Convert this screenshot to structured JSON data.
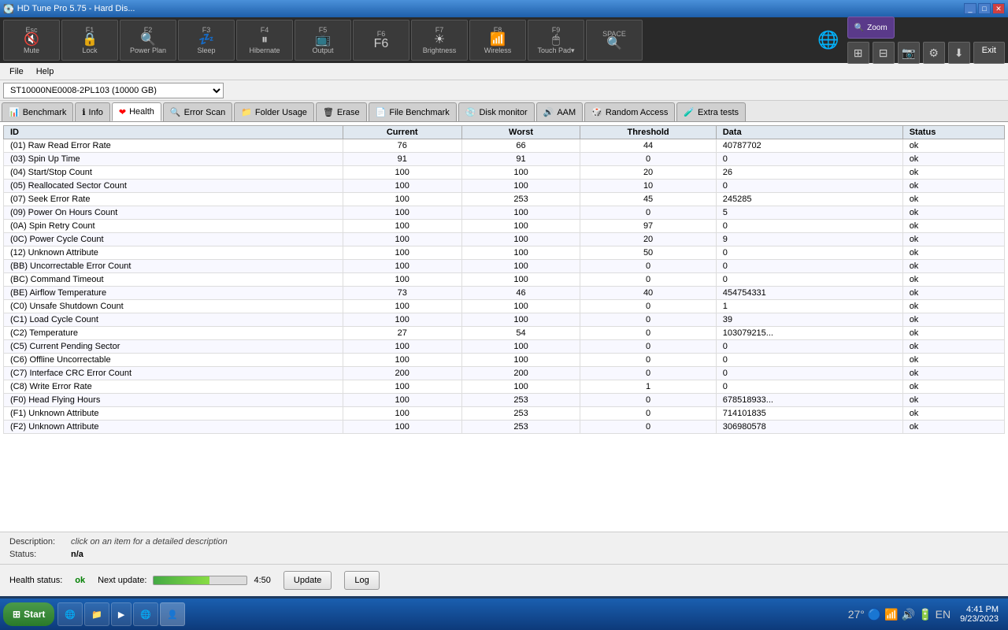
{
  "window": {
    "title": "HD Tune Pro 5.75 - Hard Dis...",
    "icon": "💽"
  },
  "fkeys": [
    {
      "key": "Esc",
      "icon": "🔇",
      "label": "Mute"
    },
    {
      "key": "F1",
      "icon": "🔒",
      "label": "Lock"
    },
    {
      "key": "F2",
      "icon": "🔍",
      "label": "Power Plan"
    },
    {
      "key": "F3",
      "icon": "💤",
      "label": "Sleep"
    },
    {
      "key": "F4",
      "icon": "⏸",
      "label": "Hibernate"
    },
    {
      "key": "F5",
      "icon": "📺",
      "label": "Output"
    },
    {
      "key": "F6",
      "icon": "F6",
      "label": ""
    },
    {
      "key": "F7",
      "icon": "☀",
      "label": "Brightness"
    },
    {
      "key": "F8",
      "icon": "📶",
      "label": "Wireless"
    },
    {
      "key": "F9",
      "icon": "🖱",
      "label": "Touch Pad"
    },
    {
      "key": "SPACE",
      "icon": "🔍",
      "label": "Zoom"
    }
  ],
  "menu": {
    "items": [
      "File",
      "Help"
    ]
  },
  "drive": {
    "label": "ST10000NE0008-2PL103 (10000 GB)"
  },
  "tabs": [
    {
      "label": "Benchmark",
      "icon": "📊"
    },
    {
      "label": "Info",
      "icon": "ℹ"
    },
    {
      "label": "Health",
      "icon": "❤",
      "active": true
    },
    {
      "label": "Error Scan",
      "icon": "🔍"
    },
    {
      "label": "Folder Usage",
      "icon": "📁"
    },
    {
      "label": "Erase",
      "icon": "🗑"
    },
    {
      "label": "File Benchmark",
      "icon": "📄"
    },
    {
      "label": "Disk monitor",
      "icon": "💿"
    },
    {
      "label": "AAM",
      "icon": "🔊"
    },
    {
      "label": "Random Access",
      "icon": "🎲"
    },
    {
      "label": "Extra tests",
      "icon": "🧪"
    }
  ],
  "table": {
    "headers": [
      "ID",
      "Current",
      "Worst",
      "Threshold",
      "Data",
      "Status"
    ],
    "rows": [
      {
        "id": "(01) Raw Read Error Rate",
        "current": "76",
        "worst": "66",
        "threshold": "44",
        "data": "40787702",
        "status": "ok"
      },
      {
        "id": "(03) Spin Up Time",
        "current": "91",
        "worst": "91",
        "threshold": "0",
        "data": "0",
        "status": "ok"
      },
      {
        "id": "(04) Start/Stop Count",
        "current": "100",
        "worst": "100",
        "threshold": "20",
        "data": "26",
        "status": "ok"
      },
      {
        "id": "(05) Reallocated Sector Count",
        "current": "100",
        "worst": "100",
        "threshold": "10",
        "data": "0",
        "status": "ok"
      },
      {
        "id": "(07) Seek Error Rate",
        "current": "100",
        "worst": "253",
        "threshold": "45",
        "data": "245285",
        "status": "ok"
      },
      {
        "id": "(09) Power On Hours Count",
        "current": "100",
        "worst": "100",
        "threshold": "0",
        "data": "5",
        "status": "ok"
      },
      {
        "id": "(0A) Spin Retry Count",
        "current": "100",
        "worst": "100",
        "threshold": "97",
        "data": "0",
        "status": "ok"
      },
      {
        "id": "(0C) Power Cycle Count",
        "current": "100",
        "worst": "100",
        "threshold": "20",
        "data": "9",
        "status": "ok"
      },
      {
        "id": "(12) Unknown Attribute",
        "current": "100",
        "worst": "100",
        "threshold": "50",
        "data": "0",
        "status": "ok"
      },
      {
        "id": "(BB) Uncorrectable Error Count",
        "current": "100",
        "worst": "100",
        "threshold": "0",
        "data": "0",
        "status": "ok"
      },
      {
        "id": "(BC) Command Timeout",
        "current": "100",
        "worst": "100",
        "threshold": "0",
        "data": "0",
        "status": "ok"
      },
      {
        "id": "(BE) Airflow Temperature",
        "current": "73",
        "worst": "46",
        "threshold": "40",
        "data": "454754331",
        "status": "ok"
      },
      {
        "id": "(C0) Unsafe Shutdown Count",
        "current": "100",
        "worst": "100",
        "threshold": "0",
        "data": "1",
        "status": "ok"
      },
      {
        "id": "(C1) Load Cycle Count",
        "current": "100",
        "worst": "100",
        "threshold": "0",
        "data": "39",
        "status": "ok"
      },
      {
        "id": "(C2) Temperature",
        "current": "27",
        "worst": "54",
        "threshold": "0",
        "data": "103079215...",
        "status": "ok"
      },
      {
        "id": "(C5) Current Pending Sector",
        "current": "100",
        "worst": "100",
        "threshold": "0",
        "data": "0",
        "status": "ok"
      },
      {
        "id": "(C6) Offline Uncorrectable",
        "current": "100",
        "worst": "100",
        "threshold": "0",
        "data": "0",
        "status": "ok"
      },
      {
        "id": "(C7) Interface CRC Error Count",
        "current": "200",
        "worst": "200",
        "threshold": "0",
        "data": "0",
        "status": "ok"
      },
      {
        "id": "(C8) Write Error Rate",
        "current": "100",
        "worst": "100",
        "threshold": "1",
        "data": "0",
        "status": "ok"
      },
      {
        "id": "(F0) Head Flying Hours",
        "current": "100",
        "worst": "253",
        "threshold": "0",
        "data": "678518933...",
        "status": "ok"
      },
      {
        "id": "(F1) Unknown Attribute",
        "current": "100",
        "worst": "253",
        "threshold": "0",
        "data": "714101835",
        "status": "ok"
      },
      {
        "id": "(F2) Unknown Attribute",
        "current": "100",
        "worst": "253",
        "threshold": "0",
        "data": "306980578",
        "status": "ok"
      }
    ]
  },
  "bottom": {
    "description_label": "Description:",
    "description_value": "click on an item for a detailed description",
    "status_label": "Status:",
    "status_value": "n/a"
  },
  "health_status": {
    "label": "Health status:",
    "value": "ok",
    "next_update_label": "Next update:",
    "timer": "4:50",
    "update_btn": "Update",
    "log_btn": "Log"
  },
  "taskbar": {
    "start_label": "Start",
    "apps": [
      "💻",
      "🌐",
      "📁",
      "▶",
      "🌐",
      "👤"
    ],
    "active_app": "HD Tune",
    "time": "4:41 PM",
    "date": "9/23/2023",
    "temp": "27°"
  }
}
